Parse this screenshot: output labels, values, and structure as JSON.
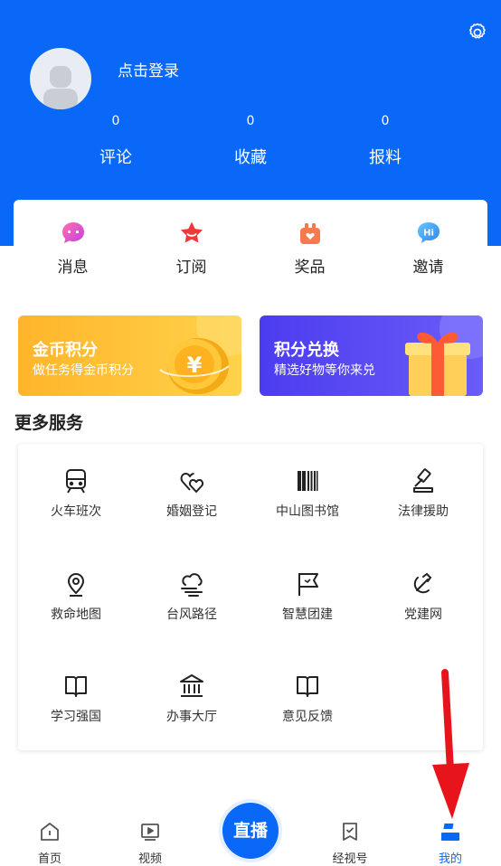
{
  "header": {
    "login_text": "点击登录",
    "stats": [
      {
        "value": "0",
        "label": "评论"
      },
      {
        "value": "0",
        "label": "收藏"
      },
      {
        "value": "0",
        "label": "报料"
      }
    ]
  },
  "quick_actions": [
    {
      "label": "消息",
      "icon": "message-icon"
    },
    {
      "label": "订阅",
      "icon": "star-icon"
    },
    {
      "label": "奖品",
      "icon": "gift-box-icon"
    },
    {
      "label": "邀请",
      "icon": "hi-bubble-icon"
    }
  ],
  "banners": [
    {
      "title": "金币积分",
      "subtitle": "做任务得金币积分"
    },
    {
      "title": "积分兑换",
      "subtitle": "精选好物等你来兑"
    }
  ],
  "more_services": {
    "title": "更多服务",
    "items": [
      {
        "label": "火车班次",
        "icon": "train-icon"
      },
      {
        "label": "婚姻登记",
        "icon": "hearts-icon"
      },
      {
        "label": "中山图书馆",
        "icon": "books-icon"
      },
      {
        "label": "法律援助",
        "icon": "gavel-icon"
      },
      {
        "label": "救命地图",
        "icon": "map-pin-icon"
      },
      {
        "label": "台风路径",
        "icon": "typhoon-cloud-icon"
      },
      {
        "label": "智慧团建",
        "icon": "flag-icon"
      },
      {
        "label": "党建网",
        "icon": "hammer-sickle-icon"
      },
      {
        "label": "学习强国",
        "icon": "open-book-icon"
      },
      {
        "label": "办事大厅",
        "icon": "government-building-icon"
      },
      {
        "label": "意见反馈",
        "icon": "feedback-book-icon"
      }
    ]
  },
  "tabbar": {
    "items": [
      {
        "label": "首页",
        "icon": "home-icon"
      },
      {
        "label": "视频",
        "icon": "video-icon"
      },
      {
        "label": "经视号",
        "icon": "bookmark-check-icon"
      },
      {
        "label": "我的",
        "icon": "profile-icon"
      }
    ],
    "live_label": "直播",
    "active": "我的"
  },
  "colors": {
    "primary": "#0a68f8",
    "annotation_arrow": "#e8141c"
  }
}
